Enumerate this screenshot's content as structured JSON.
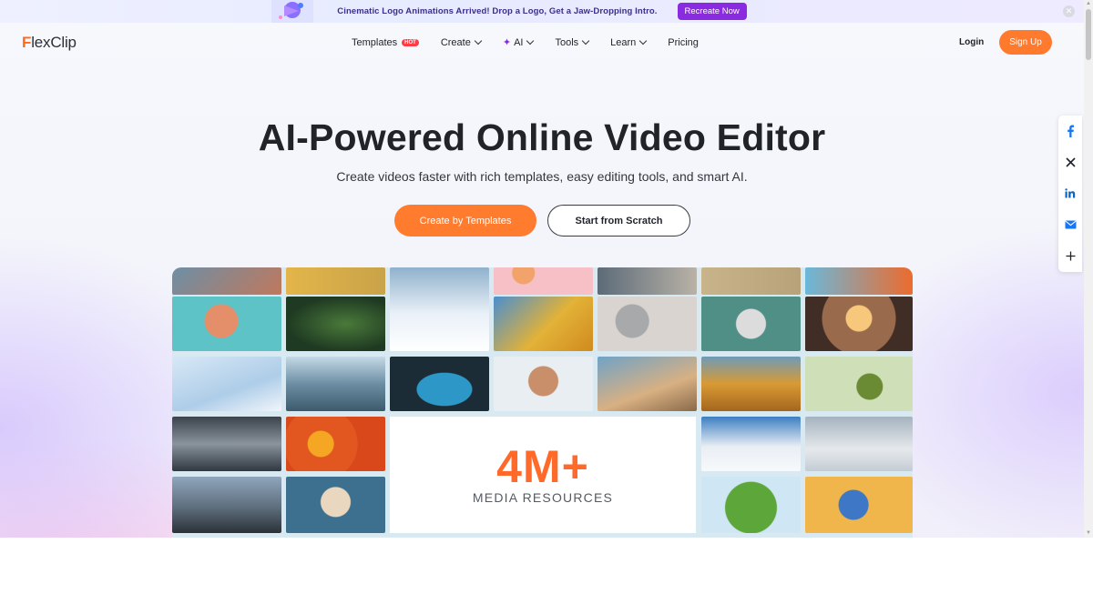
{
  "announcement": {
    "text": "Cinematic Logo Animations Arrived! Drop a Logo, Get a Jaw-Dropping Intro.",
    "button_label": "Recreate Now"
  },
  "header": {
    "logo_first": "F",
    "logo_rest": "lexClip",
    "nav": {
      "templates": "Templates",
      "hot_badge": "HOT",
      "create": "Create",
      "ai": "AI",
      "tools": "Tools",
      "learn": "Learn",
      "pricing": "Pricing"
    },
    "login": "Login",
    "signup": "Sign Up"
  },
  "hero": {
    "title": "AI-Powered Online Video Editor",
    "subtitle": "Create videos faster with rich templates, easy editing tools, and smart AI.",
    "primary_button": "Create by Templates",
    "secondary_button": "Start from Scratch"
  },
  "media": {
    "count": "4M+",
    "label": "MEDIA RESOURCES"
  },
  "share": [
    "facebook-icon",
    "x-icon",
    "linkedin-icon",
    "email-icon",
    "plus-icon"
  ],
  "colors": {
    "accent_orange": "#ff7b2e",
    "accent_purple": "#8a2be2",
    "hot_red": "#ff3b45",
    "facebook_blue": "#1877f2",
    "linkedin_blue": "#0a66c2"
  }
}
